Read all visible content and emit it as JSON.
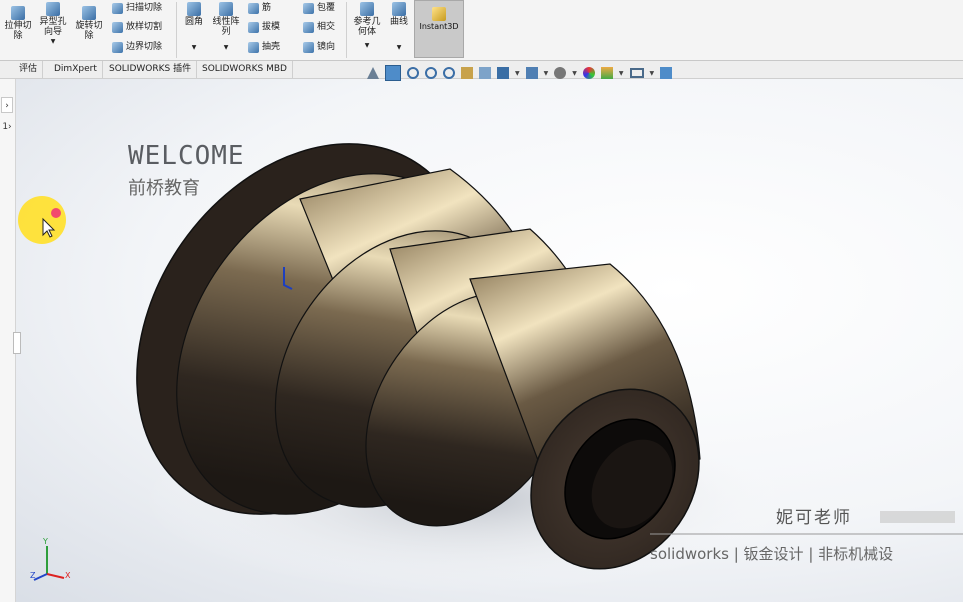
{
  "ribbon": {
    "items": {
      "extrude_cut": "拉伸切\n除",
      "hole_wizard": "异型孔\n向导",
      "revolve_cut": "旋转切\n除",
      "swept_cut": "扫描切除",
      "lofted_cut": "放样切割",
      "boundary_cut": "边界切除",
      "fillet": "圆角",
      "linear_pattern": "线性阵\n列",
      "rib": "筋",
      "draft": "拔模",
      "shell": "抽壳",
      "wrap": "包覆",
      "intersect": "相交",
      "mirror": "镜向",
      "ref_geometry": "参考几\n何体",
      "curves": "曲线",
      "instant3d": "Instant3D"
    }
  },
  "tabs": [
    "评估",
    "DimXpert",
    "SOLIDWORKS 插件",
    "SOLIDWORKS MBD"
  ],
  "sidebar": {
    "expand": "›",
    "tree_item": "1›"
  },
  "viewport": {
    "welcome": "WELCOME",
    "brand": "前桥教育",
    "teacher": "妮可老师",
    "footer": "solidworks | 钣金设计 | 非标机械设"
  },
  "triad": {
    "x": "X",
    "y": "Y",
    "z": "Z"
  },
  "colors": {
    "accent": "#3a6ea5",
    "part": "#3b3027",
    "highlight": "#ffe033"
  }
}
